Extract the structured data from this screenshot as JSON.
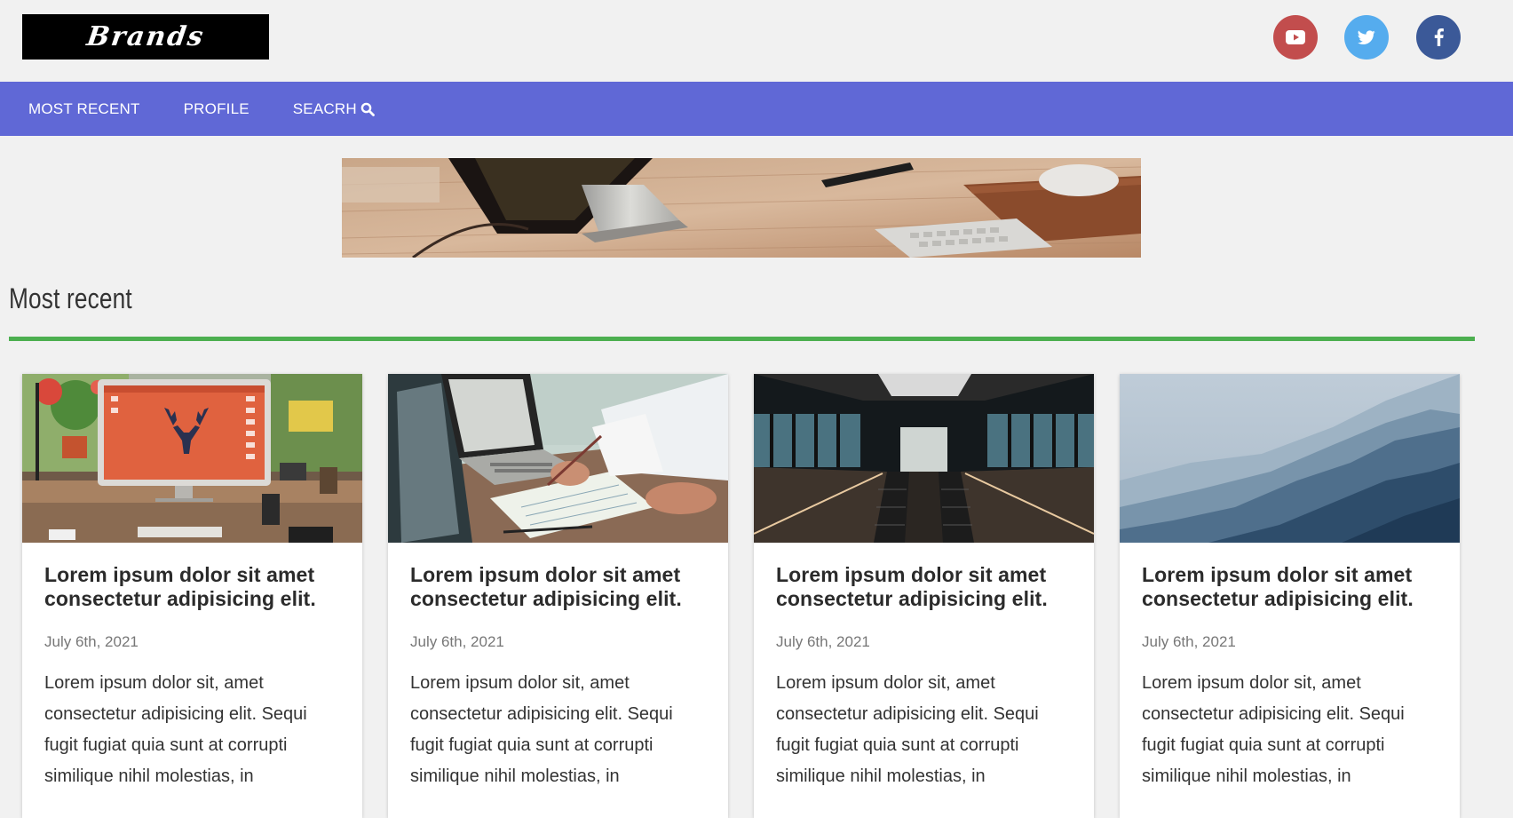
{
  "header": {
    "logo_text": "Brands",
    "social": [
      {
        "name": "youtube-icon",
        "color": "#c24d4d"
      },
      {
        "name": "twitter-icon",
        "color": "#55acee"
      },
      {
        "name": "facebook-icon",
        "color": "#3b5998"
      }
    ]
  },
  "nav": {
    "items": [
      {
        "label": "MOST RECENT"
      },
      {
        "label": "PROFILE"
      },
      {
        "label": "SEACRH",
        "icon": "search-icon"
      }
    ],
    "color": "#6068d6"
  },
  "section": {
    "title": "Most recent",
    "rule_color": "#4caf50"
  },
  "cards": [
    {
      "image": "desk-computer-photo",
      "title": "Lorem ipsum dolor sit amet consectetur adipisicing elit.",
      "date": "July 6th, 2021",
      "excerpt": "Lorem ipsum dolor sit, amet consectetur adipisicing elit. Sequi fugit fugiat quia sunt at corrupti similique nihil molestias, in"
    },
    {
      "image": "laptop-notes-photo",
      "title": "Lorem ipsum dolor sit amet consectetur adipisicing elit.",
      "date": "July 6th, 2021",
      "excerpt": "Lorem ipsum dolor sit, amet consectetur adipisicing elit. Sequi fugit fugiat quia sunt at corrupti similique nihil molestias, in"
    },
    {
      "image": "escalator-photo",
      "title": "Lorem ipsum dolor sit amet consectetur adipisicing elit.",
      "date": "July 6th, 2021",
      "excerpt": "Lorem ipsum dolor sit, amet consectetur adipisicing elit. Sequi fugit fugiat quia sunt at corrupti similique nihil molestias, in"
    },
    {
      "image": "mountains-photo",
      "title": "Lorem ipsum dolor sit amet consectetur adipisicing elit.",
      "date": "July 6th, 2021",
      "excerpt": "Lorem ipsum dolor sit, amet consectetur adipisicing elit. Sequi fugit fugiat quia sunt at corrupti similique nihil molestias, in"
    }
  ]
}
